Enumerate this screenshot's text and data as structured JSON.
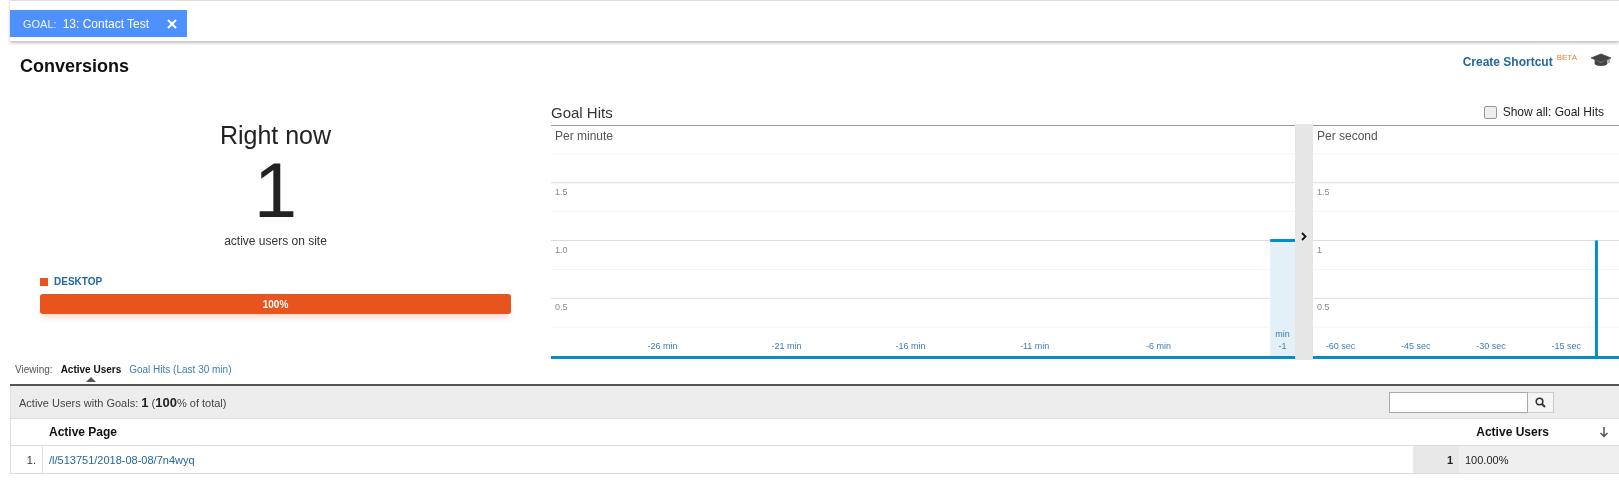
{
  "filter": {
    "label": "GOAL:",
    "value": "13: Contact Test"
  },
  "page_title": "Conversions",
  "shortcut": {
    "label": "Create Shortcut",
    "badge": "BETA"
  },
  "right_now": {
    "title": "Right now",
    "count": "1",
    "caption": "active users on site"
  },
  "devices": [
    {
      "name": "DESKTOP",
      "color": "#e8541e",
      "level": 1,
      "reading": "100%"
    }
  ],
  "goal_hits": {
    "title": "Goal Hits",
    "show_all": {
      "label": "Show all: Goal Hits",
      "checked": false
    },
    "panels": [
      {
        "kind": "minute",
        "chart_data": {
          "type": "bar",
          "title": "Per minute",
          "x": [
            -30,
            -29,
            -28,
            -27,
            -26,
            -25,
            -24,
            -23,
            -22,
            -21,
            -20,
            -19,
            -18,
            -17,
            -16,
            -15,
            -14,
            -13,
            -12,
            -11,
            -10,
            -9,
            -8,
            -7,
            -6,
            -5,
            -4,
            -3,
            -2,
            -1
          ],
          "values": [
            0,
            0,
            0,
            0,
            0,
            0,
            0,
            0,
            0,
            0,
            0,
            0,
            0,
            0,
            0,
            0,
            0,
            0,
            0,
            0,
            0,
            0,
            0,
            0,
            0,
            0,
            0,
            0,
            0,
            1
          ],
          "xlim": [
            -30.5,
            -0.5
          ],
          "ylim": [
            0,
            2
          ],
          "grid": true,
          "yticks": [
            {
              "value": 0.5,
              "label": "0.5"
            },
            {
              "value": 1,
              "label": "1.0"
            },
            {
              "value": 1.5,
              "label": "1.5"
            }
          ],
          "xticks": [
            {
              "value": -26,
              "label": "-26 min"
            },
            {
              "value": -21,
              "label": "-21 min"
            },
            {
              "value": -16,
              "label": "-16 min"
            },
            {
              "value": -11,
              "label": "-11 min"
            },
            {
              "value": -6,
              "label": "-6 min"
            },
            {
              "value": -1,
              "label": "min\n-1"
            }
          ]
        }
      },
      {
        "kind": "second",
        "chart_data": {
          "type": "bar",
          "title": "Per second",
          "x": [
            -65,
            -64,
            -63,
            -62,
            -61,
            -60,
            -59,
            -58,
            -57,
            -56,
            -55,
            -54,
            -53,
            -52,
            -51,
            -50,
            -49,
            -48,
            -47,
            -46,
            -45,
            -44,
            -43,
            -42,
            -41,
            -40,
            -39,
            -38,
            -37,
            -36,
            -35,
            -34,
            -33,
            -32,
            -31,
            -30,
            -29,
            -28,
            -27,
            -26,
            -25,
            -24,
            -23,
            -22,
            -21,
            -20,
            -19,
            -18,
            -17,
            -16,
            -15,
            -14,
            -13,
            -12,
            -11,
            -10,
            -9,
            -8,
            -7,
            -6,
            -5
          ],
          "values": [
            0,
            0,
            0,
            0,
            0,
            0,
            0,
            0,
            0,
            0,
            0,
            0,
            0,
            0,
            0,
            0,
            0,
            0,
            0,
            0,
            0,
            0,
            0,
            0,
            0,
            0,
            0,
            0,
            0,
            0,
            0,
            0,
            0,
            0,
            0,
            0,
            0,
            0,
            0,
            0,
            0,
            0,
            0,
            0,
            0,
            0,
            0,
            0,
            0,
            0,
            0,
            0,
            0,
            0,
            0,
            0,
            1,
            0,
            0,
            0,
            0
          ],
          "xlim": [
            -65.5,
            -4.5
          ],
          "ylim": [
            0,
            2
          ],
          "grid": true,
          "yticks": [
            {
              "value": 0.5,
              "label": "0.5"
            },
            {
              "value": 1,
              "label": "1"
            },
            {
              "value": 1.5,
              "label": "1.5"
            }
          ],
          "xticks": [
            {
              "value": -60,
              "label": "-60 sec"
            },
            {
              "value": -45,
              "label": "-45 sec"
            },
            {
              "value": -30,
              "label": "-30 sec"
            },
            {
              "value": -15,
              "label": "-15 sec"
            }
          ]
        }
      }
    ]
  },
  "viewing": {
    "label": "Viewing:",
    "tabs": [
      {
        "label": "Active Users",
        "selected": true
      },
      {
        "label": "Goal Hits (Last 30 min)",
        "selected": false
      }
    ]
  },
  "summary": "Active Users with Goals: **1** (**100**% of total)",
  "table": {
    "columns": [
      "Active Page",
      "Active Users"
    ],
    "rows": [
      {
        "index": "1.",
        "page": "/l/513751/2018-08-08/7n4wyq",
        "count": "1",
        "share": "100.00%"
      }
    ]
  }
}
